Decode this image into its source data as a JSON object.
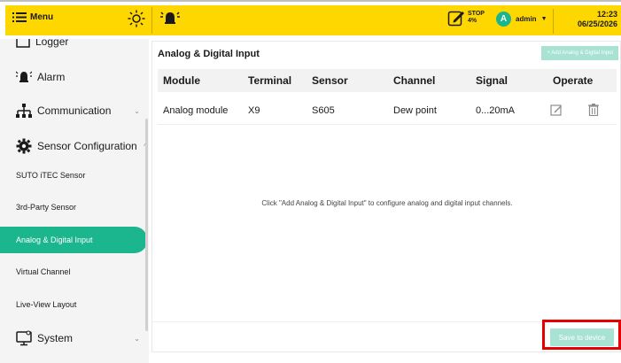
{
  "header": {
    "menu_label": "Menu",
    "stop_label": "STOP",
    "stop_value": "4%",
    "user_initial": "A",
    "user_name": "admin",
    "time": "12:23",
    "date": "06/25/2026",
    "icons": [
      "menu-icon",
      "sun-icon",
      "alarm-bell-icon",
      "edit-note-icon"
    ]
  },
  "sidebar": {
    "items": [
      {
        "label": "Logger",
        "type": "main"
      },
      {
        "label": "Alarm",
        "type": "main"
      },
      {
        "label": "Communication",
        "type": "main"
      },
      {
        "label": "Sensor Configuration",
        "type": "main"
      },
      {
        "label": "SUTO iTEC Sensor",
        "type": "sub"
      },
      {
        "label": "3rd-Party Sensor",
        "type": "sub"
      },
      {
        "label": "Analog & Digital Input",
        "type": "sub",
        "active": true
      },
      {
        "label": "Virtual Channel",
        "type": "sub"
      },
      {
        "label": "Live-View Layout",
        "type": "sub"
      },
      {
        "label": "System",
        "type": "main"
      }
    ]
  },
  "main": {
    "title": "Analog & Digital Input",
    "add_button": "+ Add Analog & Digital Input",
    "columns": [
      "Module",
      "Terminal",
      "Sensor",
      "Channel",
      "Signal",
      "Operate"
    ],
    "rows": [
      {
        "module": "Analog module",
        "terminal": "X9",
        "sensor": "S605",
        "channel": "Dew point",
        "signal": "0...20mA"
      }
    ],
    "hint": "Click \"Add Analog & Digital Input\" to configure analog and digital input channels.",
    "save_button": "Save to device"
  },
  "colors": {
    "accent": "#1bb58e",
    "header": "#ffd700",
    "highlight": "#e60000"
  }
}
